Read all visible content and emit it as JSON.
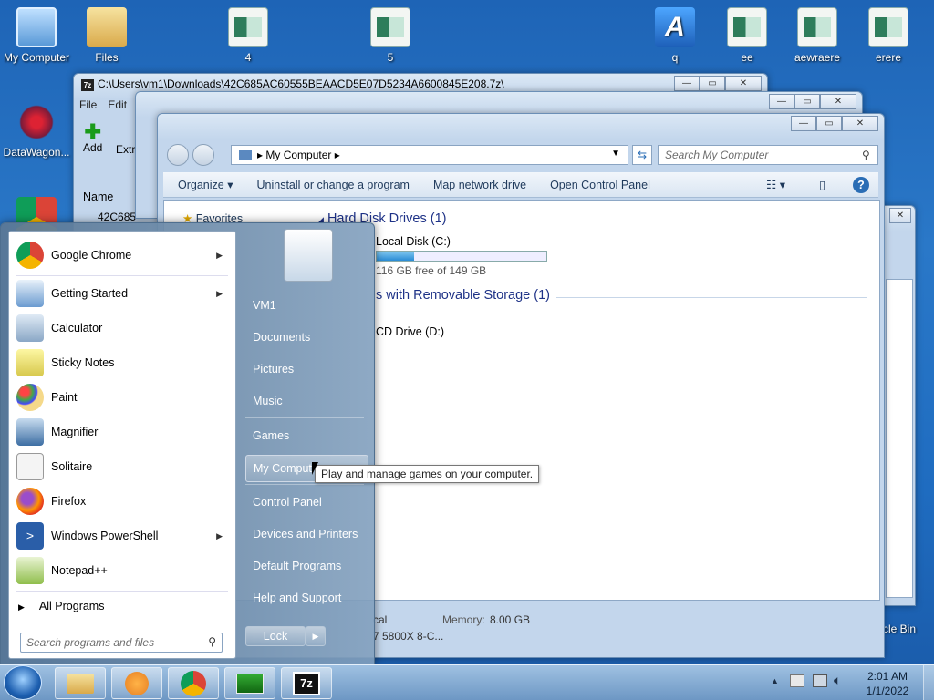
{
  "desktop": {
    "icons": [
      "My Computer",
      "Files",
      "4",
      "5",
      "q",
      "ee",
      "aewraere",
      "erere",
      "DataWagon...",
      "cle Bin"
    ]
  },
  "zip_window": {
    "title": "C:\\Users\\vm1\\Downloads\\42C685AC60555BEAACD5E07D5234A6600845E208.7z\\",
    "menu": [
      "File",
      "Edit"
    ],
    "toolbar": [
      "Add",
      "Extr"
    ],
    "column_name": "Name",
    "file_name": "42C685"
  },
  "explorer": {
    "address": [
      "My Computer"
    ],
    "search_placeholder": "Search My Computer",
    "commands": [
      "Organize",
      "Uninstall or change a program",
      "Map network drive",
      "Open Control Panel"
    ],
    "favorites": "Favorites",
    "hdd_header": "Hard Disk Drives (1)",
    "local_disk": "Local Disk (C:)",
    "disk_free": "116 GB free of 149 GB",
    "disk_used_fraction": 0.22,
    "removable_header": "s with Removable Storage (1)",
    "cd_drive": "CD Drive (D:)",
    "status_left": "cal",
    "memory_label": "Memory:",
    "memory_value": "8.00 GB",
    "cpu": "7 5800X 8-C..."
  },
  "start_menu": {
    "programs": [
      {
        "label": "Google Chrome",
        "submenu": true
      },
      {
        "label": "Getting Started",
        "submenu": true
      },
      {
        "label": "Calculator"
      },
      {
        "label": "Sticky Notes"
      },
      {
        "label": "Paint"
      },
      {
        "label": "Magnifier"
      },
      {
        "label": "Solitaire"
      },
      {
        "label": "Firefox"
      },
      {
        "label": "Windows PowerShell",
        "submenu": true
      },
      {
        "label": "Notepad++"
      }
    ],
    "all_programs": "All Programs",
    "search_placeholder": "Search programs and files",
    "right_items": [
      "VM1",
      "Documents",
      "Pictures",
      "Music",
      "Games",
      "My Comput",
      "Control Panel",
      "Devices and Printers",
      "Default Programs",
      "Help and Support"
    ],
    "lock_label": "Lock"
  },
  "tooltip": "Play and manage games on your computer.",
  "clock": {
    "time": "2:01 AM",
    "date": "1/1/2022"
  }
}
